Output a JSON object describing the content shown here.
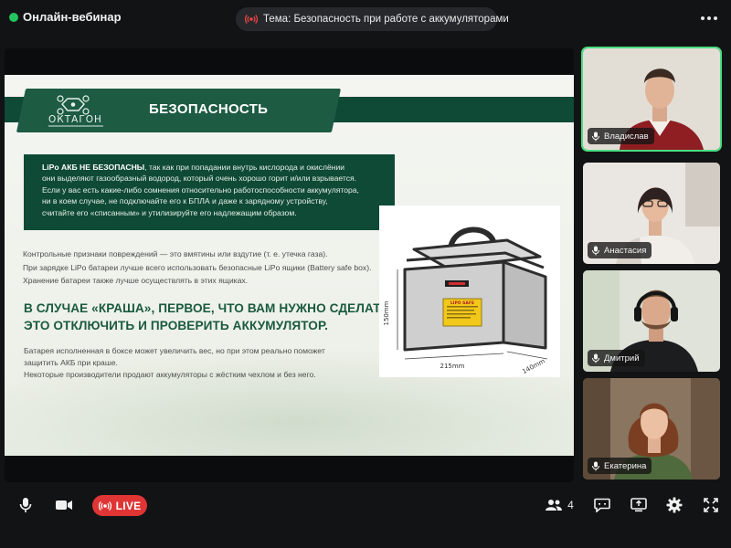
{
  "header": {
    "title": "Онлайн-вебинар",
    "topic": "Тема: Безопасность при работе с аккумуляторами"
  },
  "slide": {
    "logo_text": "ОКТАГОН",
    "heading": "БЕЗОПАСНОСТЬ",
    "warning_strong": "LiPo АКБ НЕ БЕЗОПАСНЫ",
    "warning_lines": [
      ", так как при попадании внутрь кислорода и окислёнии",
      "они выделяют газообразный водород, который очень хорошо горит и/или взрывается.",
      "Если у вас есть какие-либо сомнения относительно работоспособности аккумулятора,",
      "ни в коем случае, не подключайте его к БПЛА и даже к зарядному устройству,",
      "считайте его «списанным» и утилизируйте его надлежащим образом."
    ],
    "body_lines": [
      "Контрольные признаки повреждений — это вмятины или вздутие (т. е. утечка газа).",
      "При зарядке LiPo батареи лучше всего использовать безопасные LiPo ящики (Battery safe box).",
      "Хранение батареи также лучше осуществлять в этих ящиках."
    ],
    "crash_lines": [
      "В СЛУЧАЕ «КРАША», ПЕРВОЕ, ЧТО ВАМ НУЖНО СДЕЛАТЬ,",
      "ЭТО ОТКЛЮЧИТЬ И ПРОВЕРИТЬ АККУМУЛЯТОР."
    ],
    "bottom_lines": [
      "Батарея исполненная в боксе может увеличить вес, но при этом реально поможет",
      "защитить АКБ при краше.",
      "Некоторые производители продают аккумуляторы с жёстким чехлом и без него."
    ],
    "product": {
      "label": "LIPO SAFE",
      "dim_height": "150mm",
      "dim_width": "215mm",
      "dim_depth": "140mm"
    }
  },
  "participants": [
    {
      "name": "Владислав",
      "active": true
    },
    {
      "name": "Анастасия",
      "active": false
    },
    {
      "name": "Дмитрий",
      "active": false
    },
    {
      "name": "Екатерина",
      "active": false
    }
  ],
  "toolbar": {
    "live_label": "LIVE",
    "participant_count": "4"
  },
  "colors": {
    "accent_green": "#22c55e",
    "live_red": "#e03535",
    "slide_green": "#0f4a36"
  }
}
